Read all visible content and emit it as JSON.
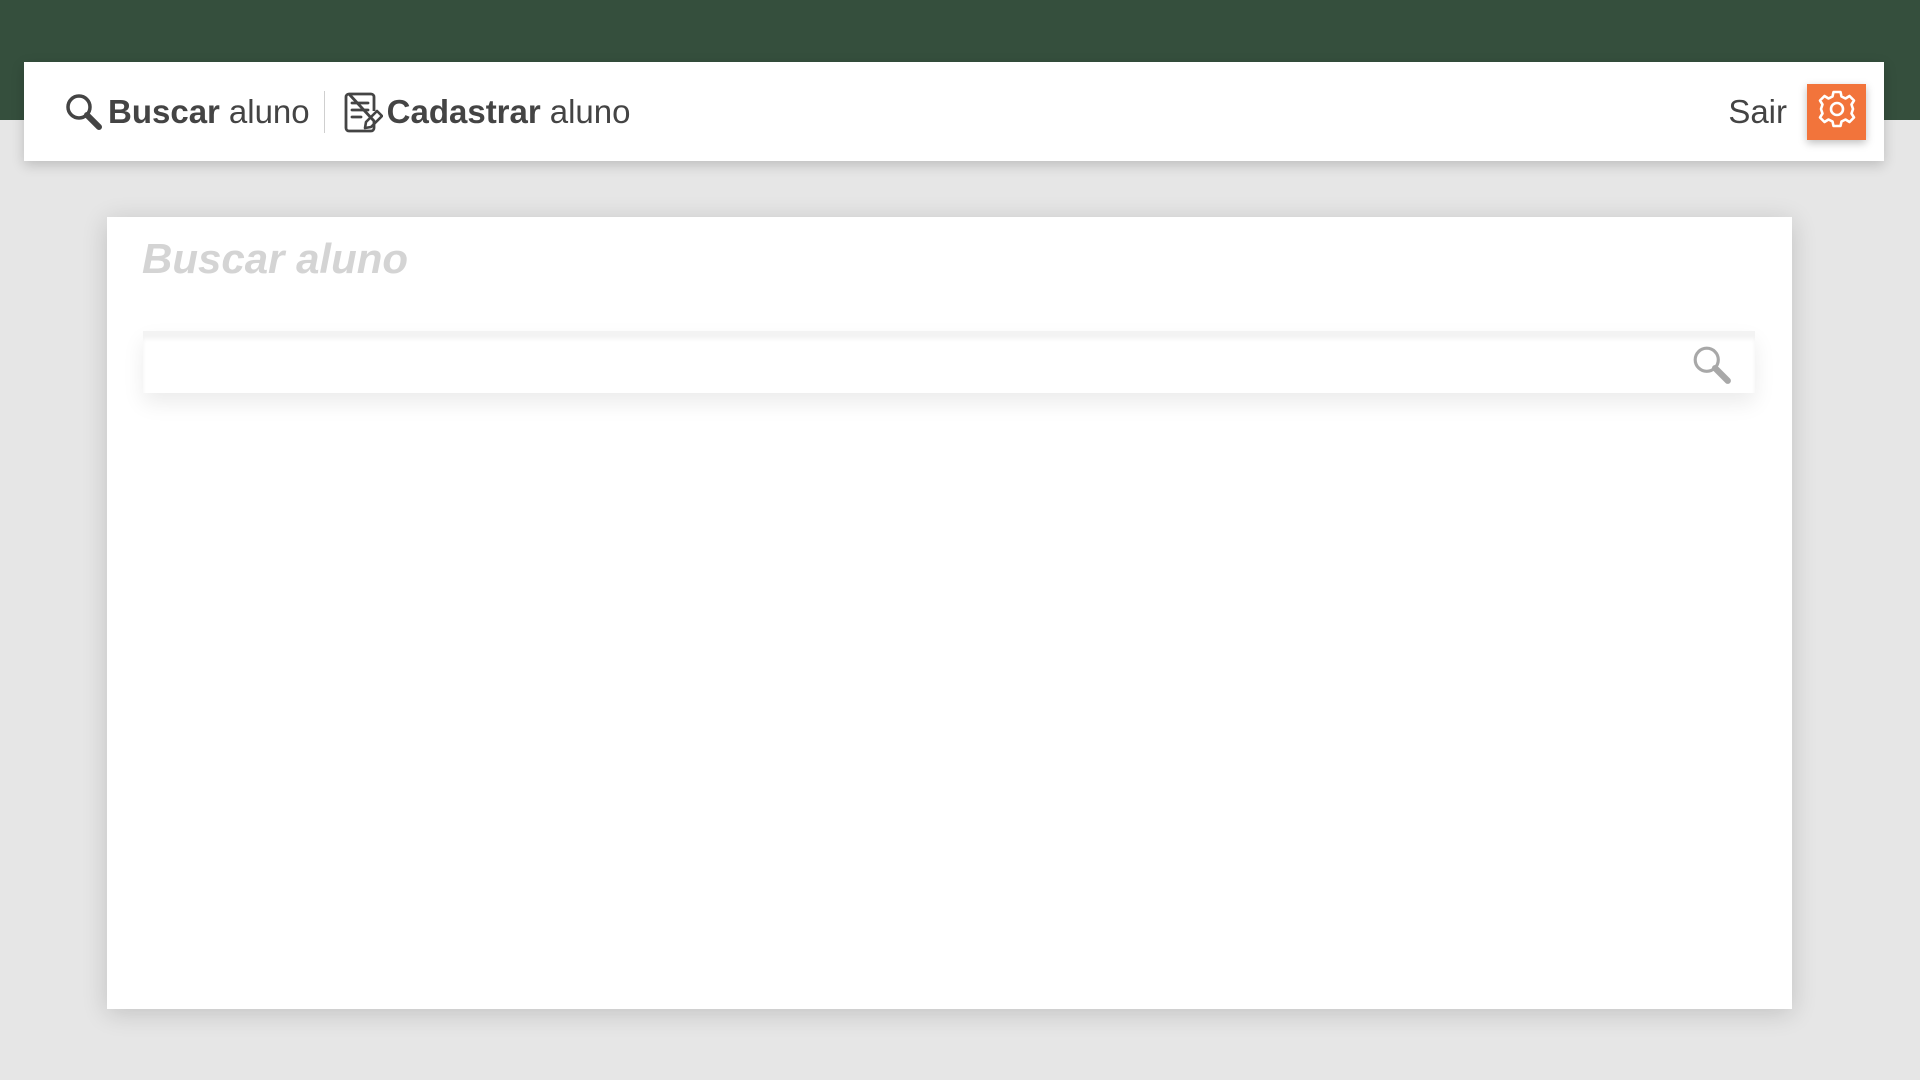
{
  "navbar": {
    "search_link": {
      "bold": "Buscar",
      "light": "aluno",
      "icon": "search-icon"
    },
    "register_link": {
      "bold": "Cadastrar",
      "light": "aluno",
      "icon": "document-edit-icon"
    },
    "logout_label": "Sair",
    "settings_icon": "gear-icon"
  },
  "main": {
    "title": "Buscar aluno",
    "search": {
      "value": "",
      "placeholder": "",
      "icon": "search-icon"
    }
  },
  "colors": {
    "header_green": "#354f3d",
    "accent_orange": "#f2743b",
    "background": "#e6e6e6"
  }
}
